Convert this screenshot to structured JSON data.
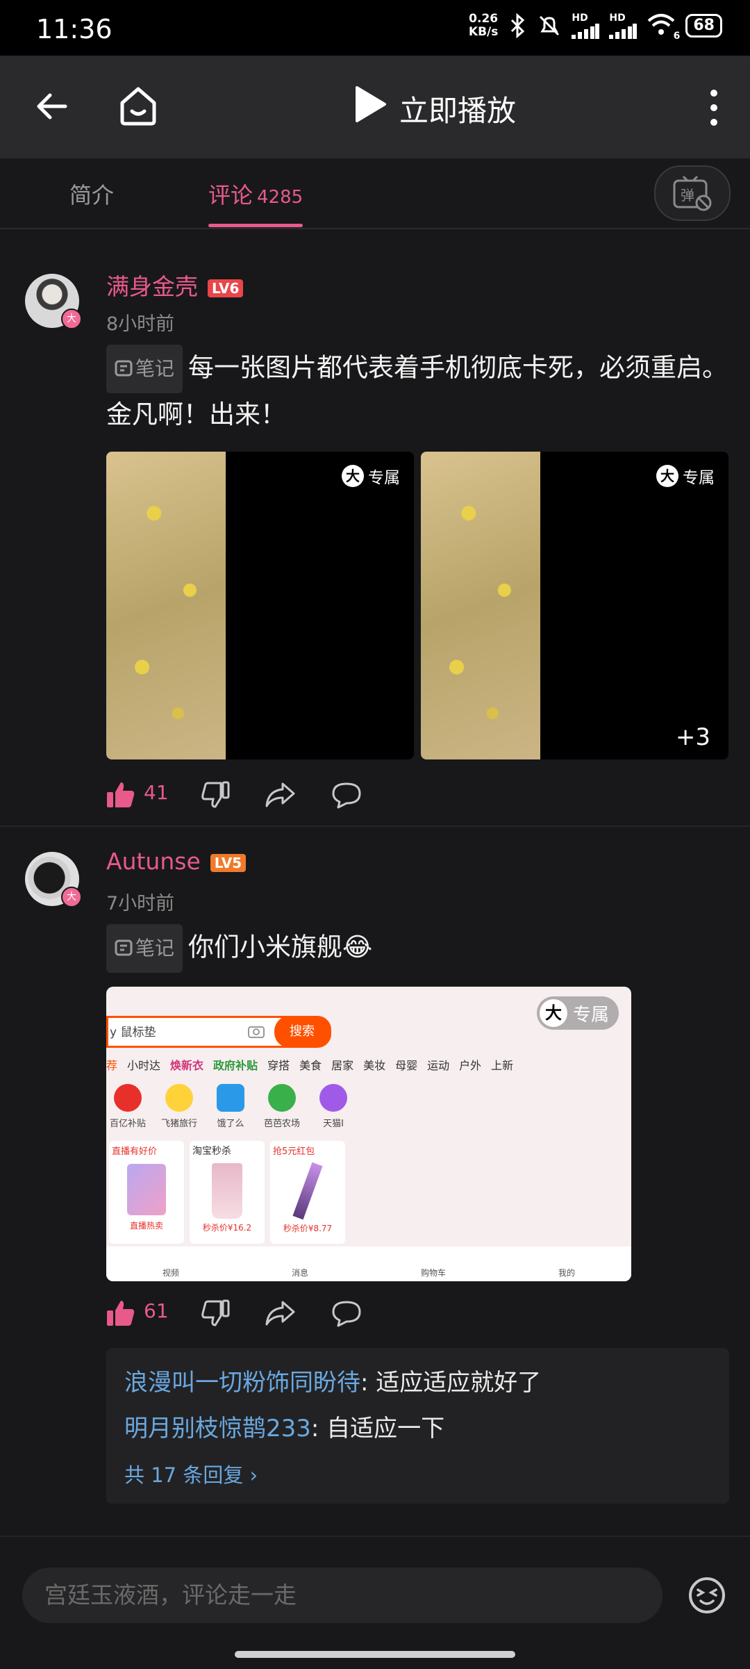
{
  "status_bar": {
    "time": "11:36",
    "net_speed_value": "0.26",
    "net_speed_unit": "KB/s",
    "signal_1": "HD",
    "signal_2": "HD",
    "wifi_sub": "6",
    "battery": "68"
  },
  "navbar": {
    "play_label": "立即播放"
  },
  "tabs": {
    "intro": "简介",
    "comments": "评论",
    "comments_count": "4285"
  },
  "comments": [
    {
      "username": "满身金壳",
      "level": "LV6",
      "level_color": "#e8464a",
      "time": "8小时前",
      "note_label": "笔记",
      "text": "每一张图片都代表着手机彻底卡死，必须重启。金凡啊！出来！",
      "image_badge": "专属",
      "badge_glyph": "大",
      "more_images": "+3",
      "likes": "41"
    },
    {
      "username": "Autunse",
      "level": "LV5",
      "level_color": "#f07a2a",
      "time": "7小时前",
      "note_label": "笔记",
      "text": "你们小米旗舰😂",
      "image_badge": "专属",
      "badge_glyph": "大",
      "likes": "61",
      "screenshot": {
        "search_text": "y 鼠标垫",
        "search_button": "搜索",
        "categories": [
          "荐",
          "小时达",
          "焕新衣",
          "政府补贴",
          "穿搭",
          "美食",
          "居家",
          "美妆",
          "母婴",
          "运动",
          "户外",
          "上新"
        ],
        "icons": [
          "百亿补贴",
          "飞猪旅行",
          "饿了么",
          "芭芭农场",
          "天猫I"
        ],
        "cards": [
          {
            "title": "直播有好价",
            "foot": "直播热卖"
          },
          {
            "title": "淘宝秒杀",
            "foot": "秒杀价¥16.2"
          },
          {
            "title": "抢5元红包",
            "foot": "秒杀价¥8.77"
          }
        ],
        "tabbar": [
          "视频",
          "消息",
          "购物车",
          "我的"
        ]
      },
      "replies": [
        {
          "name": "浪漫叫一切粉饰同盼待",
          "text": ": 适应适应就好了"
        },
        {
          "name": "明月别枝惊鹊233",
          "text": ": 自适应一下"
        }
      ],
      "replies_total": "共 17 条回复 ›"
    }
  ],
  "input": {
    "placeholder": "宫廷玉液酒，评论走一走"
  },
  "colors": {
    "accent": "#e85a8a",
    "reply_name": "#6aa8e0",
    "background": "#18181a"
  }
}
